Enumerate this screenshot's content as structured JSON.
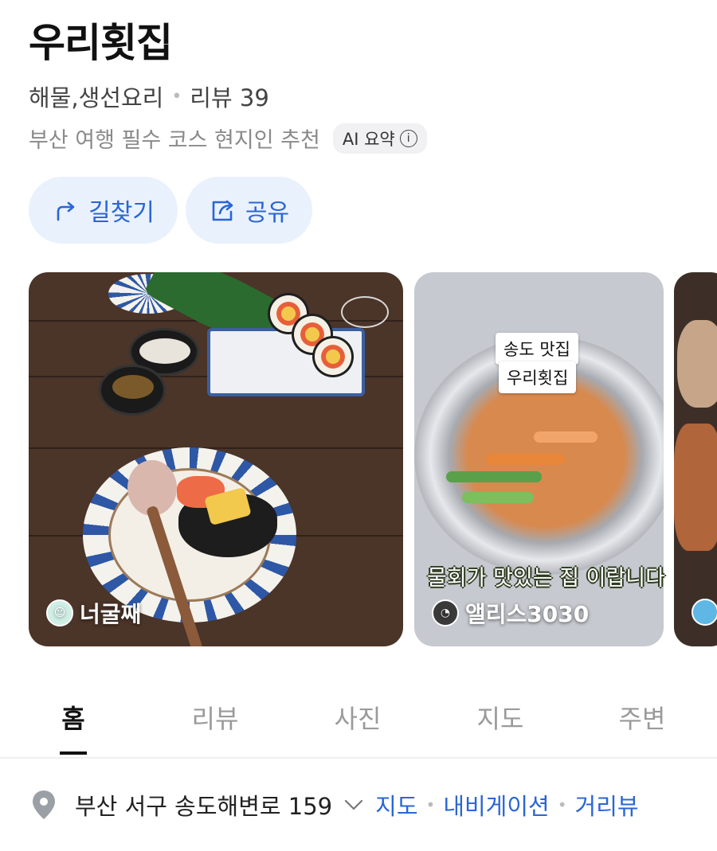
{
  "place": {
    "name": "우리횟집",
    "category": "해물,생선요리",
    "review_label": "리뷰 39",
    "summary": "부산 여행 필수 코스 현지인 추천",
    "ai_chip": "AI 요약",
    "info_glyph": "i"
  },
  "actions": {
    "directions_label": "길찾기",
    "share_label": "공유"
  },
  "photos": [
    {
      "author": "너굴째",
      "overlay_caption": "",
      "tags": []
    },
    {
      "author": "앨리스3030",
      "overlay_caption": "물회가 맛있는 집 이랍니다",
      "tags": [
        "송도 맛집",
        "우리횟집"
      ]
    },
    {
      "author": "",
      "overlay_caption": "",
      "tags": []
    }
  ],
  "tabs": [
    {
      "label": "홈",
      "active": true
    },
    {
      "label": "리뷰",
      "active": false
    },
    {
      "label": "사진",
      "active": false
    },
    {
      "label": "지도",
      "active": false
    },
    {
      "label": "주변",
      "active": false
    }
  ],
  "address": {
    "text": "부산 서구 송도해변로 159",
    "links": [
      "지도",
      "내비게이션",
      "거리뷰"
    ]
  },
  "colors": {
    "accent": "#2a66d3",
    "button_bg": "#e9f1fc",
    "muted_text": "#8a8a8a"
  }
}
